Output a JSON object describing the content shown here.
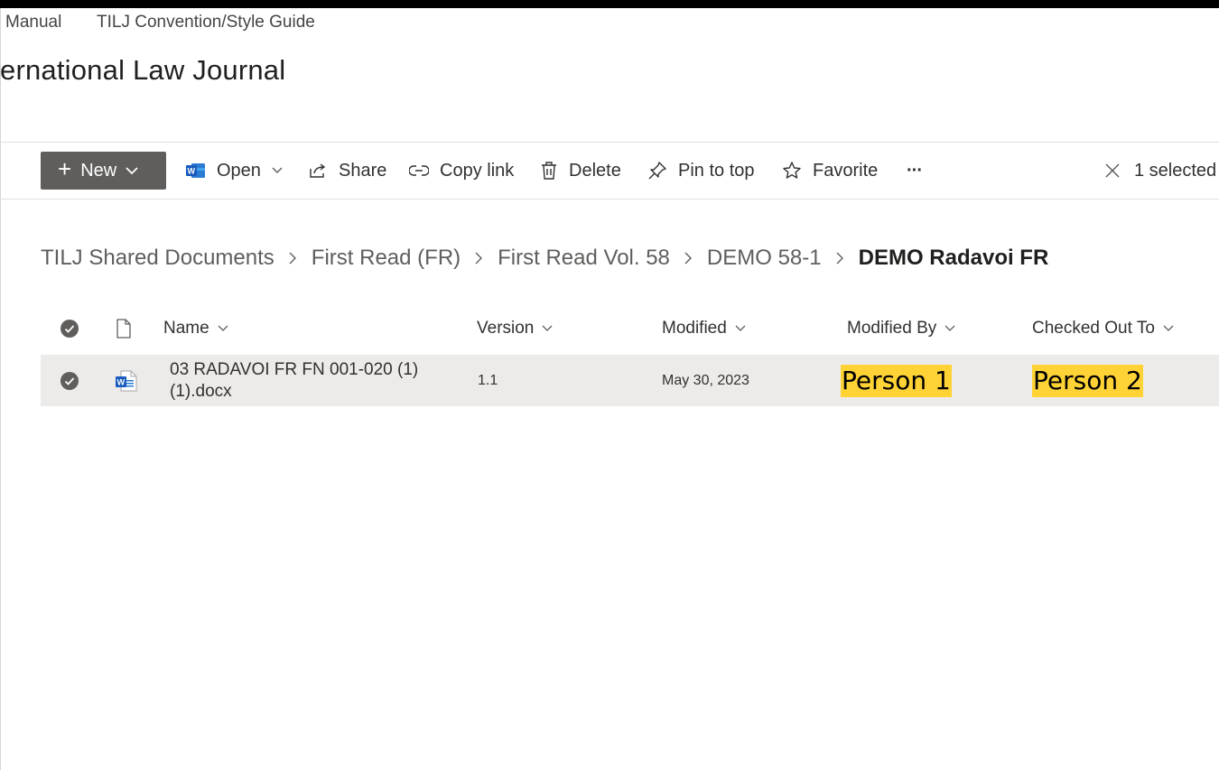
{
  "top_nav": {
    "items": [
      "Manual",
      "TILJ Convention/Style Guide"
    ]
  },
  "site": {
    "title": "ernational Law Journal"
  },
  "command_bar": {
    "new_label": "New",
    "open_label": "Open",
    "share_label": "Share",
    "copy_link_label": "Copy link",
    "delete_label": "Delete",
    "pin_label": "Pin to top",
    "favorite_label": "Favorite",
    "more_label": "···",
    "selected_label": "1 selected"
  },
  "breadcrumb": {
    "items": [
      "TILJ Shared Documents",
      "First Read (FR)",
      "First Read Vol. 58",
      "DEMO 58-1"
    ],
    "current": "DEMO Radavoi FR"
  },
  "table": {
    "columns": {
      "name": "Name",
      "version": "Version",
      "modified": "Modified",
      "modified_by": "Modified By",
      "checked_out_to": "Checked Out To"
    },
    "rows": [
      {
        "name_line1": "03 RADAVOI FR FN 001-020 (1)",
        "name_line2": "(1).docx",
        "version": "1.1",
        "modified": "May 30, 2023",
        "modified_by": "Person 1",
        "checked_out_to": "Person 2"
      }
    ]
  },
  "colors": {
    "accent_highlight": "#ffd335",
    "new_button": "#605e5c",
    "selected_row": "#edebe9",
    "word_blue": "#185abd"
  },
  "icons": [
    "plus-icon",
    "chevron-down-icon",
    "word-icon",
    "share-icon",
    "link-icon",
    "trash-icon",
    "pin-icon",
    "star-icon",
    "close-icon",
    "chevron-right-icon",
    "check-circle-icon",
    "file-icon"
  ]
}
